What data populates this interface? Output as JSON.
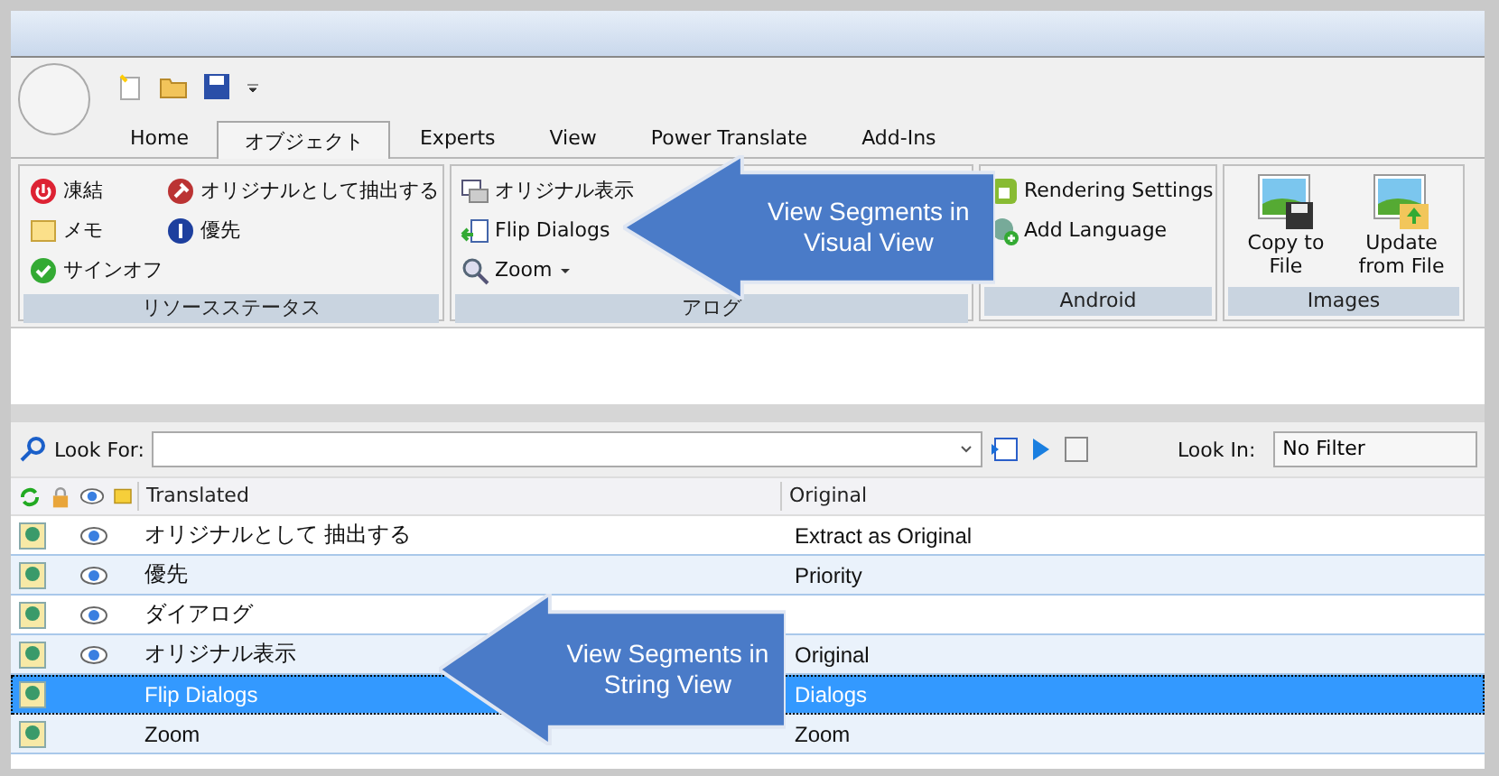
{
  "tabs": [
    {
      "label": "Home",
      "selected": false
    },
    {
      "label": "オブジェクト",
      "selected": true
    },
    {
      "label": "Experts",
      "selected": false
    },
    {
      "label": "View",
      "selected": false
    },
    {
      "label": "Power Translate",
      "selected": false
    },
    {
      "label": "Add-Ins",
      "selected": false
    }
  ],
  "ribbon_groups": [
    {
      "label": "リソースステータス",
      "kind": "grid",
      "items": [
        {
          "label": "凍結"
        },
        {
          "label": "オリジナルとして抽出する"
        },
        {
          "label": "メモ"
        },
        {
          "label": "優先"
        },
        {
          "label": "サインオフ"
        }
      ]
    },
    {
      "label": "アログ",
      "kind": "list",
      "items": [
        {
          "label": "オリジナル表示"
        },
        {
          "label": "Flip Dialogs"
        },
        {
          "label": "Zoom",
          "dropdown": true
        }
      ]
    },
    {
      "label": "Android",
      "kind": "list",
      "items": [
        {
          "label": "Rendering Settings"
        },
        {
          "label": "Add Language"
        }
      ]
    },
    {
      "label": "Images",
      "kind": "large",
      "items": [
        {
          "label": "Copy to File"
        },
        {
          "label": "Update from File"
        }
      ]
    }
  ],
  "search": {
    "look_for_label": "Look For:",
    "look_in_label": "Look In:",
    "look_in_value": "No Filter"
  },
  "table": {
    "columns": [
      "Translated",
      "Original"
    ],
    "rows": [
      {
        "translated": "オリジナルとして 抽出する",
        "original": "Extract as Original",
        "visible": true,
        "selected": false
      },
      {
        "translated": "優先",
        "original": "Priority",
        "visible": true,
        "selected": false
      },
      {
        "translated": "ダイアログ",
        "visible": true,
        "selected": false
      },
      {
        "translated": "オリジナル表示",
        "original": "Original",
        "visible": true,
        "selected": false
      },
      {
        "translated": "Flip Dialogs",
        "original": "Dialogs",
        "visible": false,
        "selected": true
      },
      {
        "translated": "Zoom",
        "original": "Zoom",
        "visible": false,
        "selected": false
      }
    ]
  },
  "callouts": [
    {
      "lines": [
        "View Segments in",
        "Visual View"
      ]
    },
    {
      "lines": [
        "View Segments in",
        "String View"
      ]
    }
  ]
}
